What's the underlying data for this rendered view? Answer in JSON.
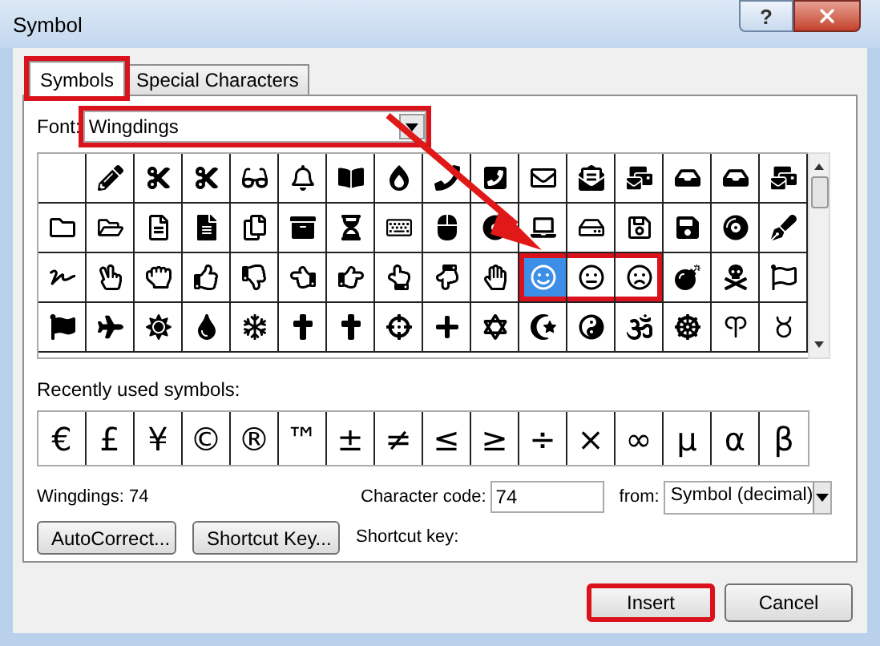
{
  "window": {
    "title": "Symbol",
    "help_button": "?"
  },
  "tabs": [
    {
      "label": "Symbols",
      "selected": true,
      "highlighted": true
    },
    {
      "label": "Special Characters",
      "selected": false,
      "highlighted": false
    }
  ],
  "font": {
    "label": "Font:",
    "value": "Wingdings",
    "highlighted": true
  },
  "symbol_grid": {
    "rows": [
      [
        {
          "selected": false,
          "highlighted": false
        },
        {
          "selected": false,
          "highlighted": false
        },
        {
          "selected": false,
          "highlighted": false
        },
        {
          "selected": false,
          "highlighted": false
        },
        {
          "selected": false,
          "highlighted": false
        },
        {
          "selected": false,
          "highlighted": false
        },
        {
          "selected": false,
          "highlighted": false
        },
        {
          "selected": false,
          "highlighted": false
        },
        {
          "selected": false,
          "highlighted": false
        },
        {
          "selected": false,
          "highlighted": false
        },
        {
          "selected": false,
          "highlighted": false
        },
        {
          "selected": false,
          "highlighted": false
        },
        {
          "selected": false,
          "highlighted": false
        },
        {
          "selected": false,
          "highlighted": false
        },
        {
          "selected": false,
          "highlighted": false
        },
        {
          "selected": false,
          "highlighted": false
        }
      ],
      [
        {
          "selected": false,
          "highlighted": false
        },
        {
          "selected": false,
          "highlighted": false
        },
        {
          "selected": false,
          "highlighted": false
        },
        {
          "selected": false,
          "highlighted": false
        },
        {
          "selected": false,
          "highlighted": false
        },
        {
          "selected": false,
          "highlighted": false
        },
        {
          "selected": false,
          "highlighted": false
        },
        {
          "selected": false,
          "highlighted": false
        },
        {
          "selected": false,
          "highlighted": false
        },
        {
          "selected": false,
          "highlighted": false
        },
        {
          "selected": false,
          "highlighted": false
        },
        {
          "selected": false,
          "highlighted": false
        },
        {
          "selected": false,
          "highlighted": false
        },
        {
          "selected": false,
          "highlighted": false
        },
        {
          "selected": false,
          "highlighted": false
        },
        {
          "selected": false,
          "highlighted": false
        }
      ],
      [
        {
          "selected": false,
          "highlighted": false
        },
        {
          "selected": false,
          "highlighted": false
        },
        {
          "selected": false,
          "highlighted": false
        },
        {
          "selected": false,
          "highlighted": false
        },
        {
          "selected": false,
          "highlighted": false
        },
        {
          "selected": false,
          "highlighted": false
        },
        {
          "selected": false,
          "highlighted": false
        },
        {
          "selected": false,
          "highlighted": false
        },
        {
          "selected": false,
          "highlighted": false
        },
        {
          "selected": false,
          "highlighted": false
        },
        {
          "selected": true,
          "highlighted": true
        },
        {
          "selected": false,
          "highlighted": true
        },
        {
          "selected": false,
          "highlighted": true
        },
        {
          "selected": false,
          "highlighted": false
        },
        {
          "selected": false,
          "highlighted": false
        },
        {
          "selected": false,
          "highlighted": false
        }
      ],
      [
        {
          "selected": false,
          "highlighted": false
        },
        {
          "selected": false,
          "highlighted": false
        },
        {
          "selected": false,
          "highlighted": false
        },
        {
          "selected": false,
          "highlighted": false
        },
        {
          "selected": false,
          "highlighted": false
        },
        {
          "selected": false,
          "highlighted": false
        },
        {
          "selected": false,
          "highlighted": false
        },
        {
          "selected": false,
          "highlighted": false
        },
        {
          "selected": false,
          "highlighted": false
        },
        {
          "selected": false,
          "highlighted": false
        },
        {
          "selected": false,
          "highlighted": false
        },
        {
          "selected": false,
          "highlighted": false
        },
        {
          "selected": false,
          "highlighted": false
        },
        {
          "selected": false,
          "highlighted": false
        },
        {
          "selected": false,
          "highlighted": false
        },
        {
          "selected": false,
          "highlighted": false
        }
      ]
    ]
  },
  "recently_used": {
    "label": "Recently used symbols:",
    "symbols": [
      "€",
      "£",
      "¥",
      "©",
      "®",
      "™",
      "±",
      "≠",
      "≤",
      "≥",
      "÷",
      "×",
      "∞",
      "µ",
      "α",
      "β"
    ]
  },
  "status": "Wingdings: 74",
  "character_code": {
    "label": "Character code:",
    "value": "74"
  },
  "from": {
    "label": "from:",
    "value": "Symbol (decimal)"
  },
  "autocorrect_button": "AutoCorrect...",
  "shortcut_key_button": "Shortcut Key...",
  "shortcut_key_label": "Shortcut key:",
  "footer_buttons": [
    {
      "label": "Insert",
      "highlighted": true
    },
    {
      "label": "Cancel",
      "highlighted": false
    }
  ]
}
